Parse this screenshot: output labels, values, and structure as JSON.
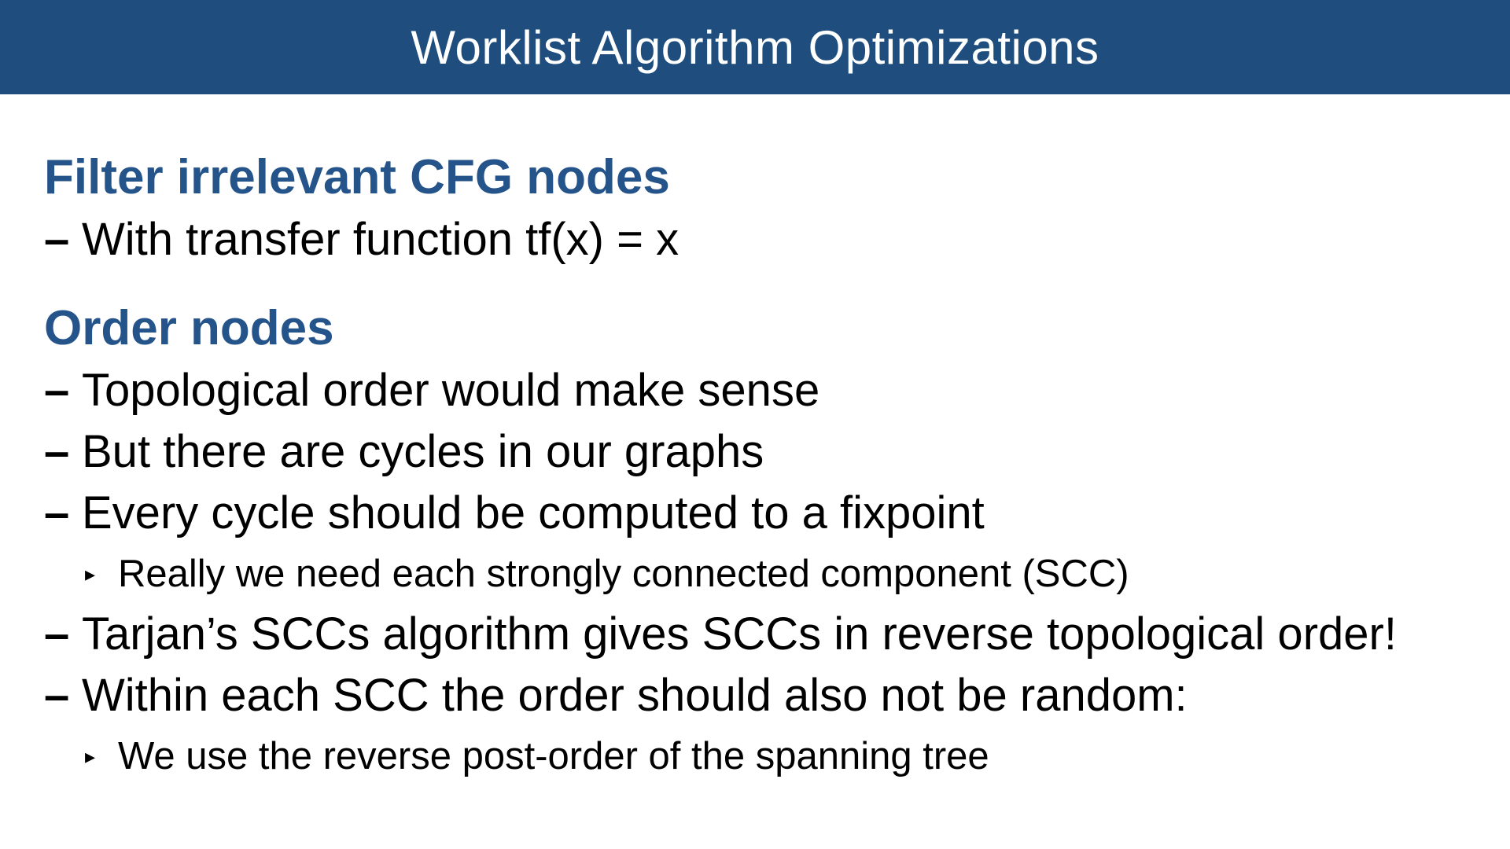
{
  "slide": {
    "title": "Worklist Algorithm Optimizations",
    "sections": [
      {
        "heading": "Filter irrelevant CFG nodes",
        "items": [
          {
            "text": "With transfer function tf(x) = x"
          }
        ]
      },
      {
        "heading": "Order nodes",
        "items": [
          {
            "text": "Topological order would make sense"
          },
          {
            "text": "But there are cycles in our graphs"
          },
          {
            "text": "Every cycle should be computed to a fixpoint",
            "sub": "Really we need each strongly connected component (SCC)"
          },
          {
            "text": "Tarjan’s SCCs algorithm gives SCCs in reverse topological order!"
          },
          {
            "text": "Within each SCC the order should also not be random:",
            "sub": "We use the reverse post-order of the spanning tree"
          }
        ]
      }
    ],
    "bullet_glyph": "–",
    "sub_bullet_glyph": "▸",
    "colors": {
      "title_bar": "#1f4e7e",
      "title_text": "#ffffff",
      "heading": "#25548a",
      "body_text": "#000000"
    }
  }
}
